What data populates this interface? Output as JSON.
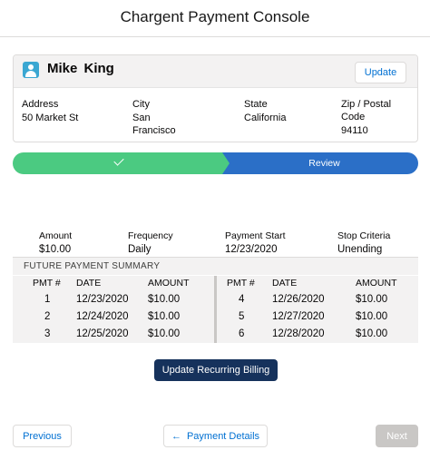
{
  "console_title": "Chargent Payment Console",
  "customer": {
    "name": "Mike  King",
    "update_label": "Update",
    "address": {
      "address_label": "Address",
      "address_value": "50 Market St",
      "city_label": "City",
      "city_line1": "San",
      "city_line2": "Francisco",
      "state_label": "State",
      "state_value": "California",
      "zip_label": "Zip / Postal Code",
      "zip_value": "94110"
    }
  },
  "path": {
    "current_label": "Review"
  },
  "summary": {
    "amount_label": "Amount",
    "amount_value": "$10.00",
    "frequency_label": "Frequency",
    "frequency_value": "Daily",
    "start_label": "Payment Start",
    "start_value": "12/23/2020",
    "stop_label": "Stop Criteria",
    "stop_value": "Unending"
  },
  "future": {
    "title": "FUTURE PAYMENT SUMMARY",
    "headers": {
      "pmt": "PMT #",
      "date": "DATE",
      "amount": "AMOUNT"
    },
    "left": [
      {
        "pmt": "1",
        "date": "12/23/2020",
        "amount": "$10.00"
      },
      {
        "pmt": "2",
        "date": "12/24/2020",
        "amount": "$10.00"
      },
      {
        "pmt": "3",
        "date": "12/25/2020",
        "amount": "$10.00"
      }
    ],
    "right": [
      {
        "pmt": "4",
        "date": "12/26/2020",
        "amount": "$10.00"
      },
      {
        "pmt": "5",
        "date": "12/27/2020",
        "amount": "$10.00"
      },
      {
        "pmt": "6",
        "date": "12/28/2020",
        "amount": "$10.00"
      }
    ]
  },
  "buttons": {
    "recurring": "Update Recurring Billing",
    "previous": "Previous",
    "payment_details": "Payment Details",
    "next": "Next"
  },
  "colors": {
    "path_complete": "#4bca81",
    "path_current": "#2b6fc7",
    "brand_dark": "#16325c",
    "link_blue": "#0070d2",
    "avatar": "#3ba7d2"
  },
  "icons": {
    "avatar": "contact-icon",
    "path_complete": "checkmark-icon",
    "back": "arrow-left-icon"
  }
}
